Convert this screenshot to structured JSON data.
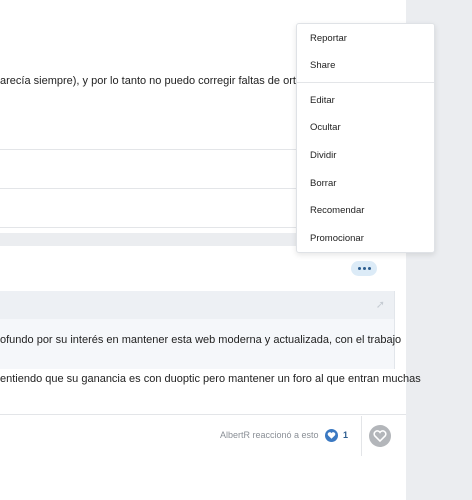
{
  "post": {
    "text_line": "arecía siempre), y por lo tanto no puedo corregir faltas de ortogra",
    "quote_text": "ofundo por su interés en mantener esta web moderna y actualizada, con el trabajo",
    "body_text": "entiendo que su ganancia es con duoptic pero mantener un foro al que entran muchas"
  },
  "reactions": {
    "summary": "AlbertR reaccionó a esto",
    "count": "1"
  },
  "menu": {
    "items": [
      "Reportar",
      "Share",
      "Editar",
      "Ocultar",
      "Dividir",
      "Borrar",
      "Recomendar",
      "Promocionar"
    ]
  },
  "icons": {
    "more": "more-dots-icon",
    "share_arrow": "share-arrow-icon",
    "reaction": "heart-icon",
    "like": "heart-outline-icon"
  },
  "colors": {
    "accent": "#3b79c2",
    "gutter": "#ebedf0"
  }
}
